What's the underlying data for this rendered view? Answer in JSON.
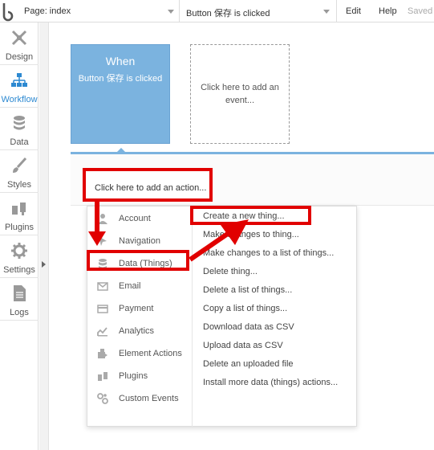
{
  "topbar": {
    "page_label": "Page: index",
    "event_label": "Button 保存 is clicked",
    "edit": "Edit",
    "help": "Help",
    "saved": "Saved"
  },
  "sidebar": {
    "items": [
      {
        "label": "Design",
        "icon": "design-icon"
      },
      {
        "label": "Workflow",
        "icon": "workflow-icon",
        "active": true
      },
      {
        "label": "Data",
        "icon": "database-icon"
      },
      {
        "label": "Styles",
        "icon": "brush-icon"
      },
      {
        "label": "Plugins",
        "icon": "plug-icon"
      },
      {
        "label": "Settings",
        "icon": "gear-icon"
      },
      {
        "label": "Logs",
        "icon": "document-icon"
      }
    ]
  },
  "canvas": {
    "when_title": "When",
    "when_event": "Button 保存 is clicked",
    "add_event": "Click here to add an event...",
    "add_action": "Click here to add an action..."
  },
  "dropdown": {
    "categories": [
      {
        "label": "Account",
        "icon": "account-icon"
      },
      {
        "label": "Navigation",
        "icon": "navigation-icon"
      },
      {
        "label": "Data (Things)",
        "icon": "database-icon"
      },
      {
        "label": "Email",
        "icon": "email-icon"
      },
      {
        "label": "Payment",
        "icon": "payment-icon"
      },
      {
        "label": "Analytics",
        "icon": "analytics-icon"
      },
      {
        "label": "Element Actions",
        "icon": "element-actions-icon"
      },
      {
        "label": "Plugins",
        "icon": "plug-icon"
      },
      {
        "label": "Custom Events",
        "icon": "custom-events-icon"
      }
    ],
    "actions": [
      "Create a new thing...",
      "Make changes to thing...",
      "Make changes to a list of things...",
      "Delete thing...",
      "Delete a list of things...",
      "Copy a list of things...",
      "Download data as CSV",
      "Upload data as CSV",
      "Delete an uploaded file",
      "Install more data (things) actions..."
    ]
  },
  "colors": {
    "accent": "#7bb3df",
    "annotation": "#e10000",
    "active_text": "#2d89d1"
  }
}
